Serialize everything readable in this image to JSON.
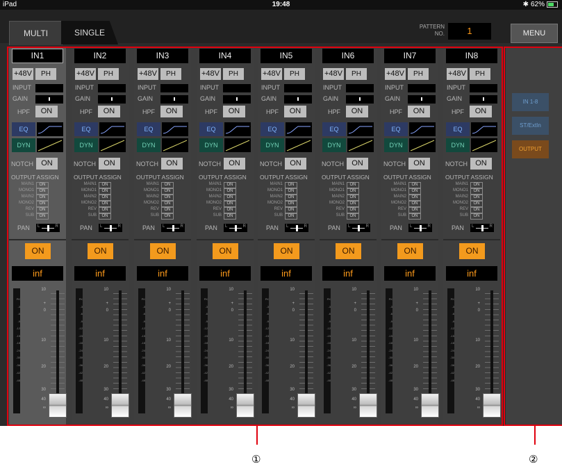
{
  "status": {
    "device": "iPad",
    "time": "19:48",
    "battery": "62%"
  },
  "tabs": {
    "multi": "MULTI",
    "single": "SINGLE"
  },
  "pattern": {
    "label_line1": "PATTERN",
    "label_line2": "NO.",
    "value": "1"
  },
  "menu": {
    "label": "MENU"
  },
  "channels": [
    {
      "name": "IN1"
    },
    {
      "name": "IN2"
    },
    {
      "name": "IN3"
    },
    {
      "name": "IN4"
    },
    {
      "name": "IN5"
    },
    {
      "name": "IN6"
    },
    {
      "name": "IN7"
    },
    {
      "name": "IN8"
    }
  ],
  "strip": {
    "phantom_label": "+48V",
    "ph_label": "PH",
    "input_label": "INPUT",
    "gain_label": "GAIN",
    "hpf_label": "HPF",
    "on_label": "ON",
    "eq_label": "EQ",
    "dyn_label": "DYN",
    "notch_label": "NOTCH",
    "output_assign_label": "OUTPUT ASSIGN",
    "assign": [
      {
        "label": "MAIN1",
        "state": "ON"
      },
      {
        "label": "MONO1",
        "state": "ON"
      },
      {
        "label": "MAIN2",
        "state": "ON"
      },
      {
        "label": "MONO2",
        "state": "ON"
      },
      {
        "label": "REV",
        "state": "ON"
      },
      {
        "label": "SUB",
        "state": "ON"
      }
    ],
    "pan_label": "PAN",
    "pan_l": "L",
    "pan_r": "R",
    "channel_on_label": "ON",
    "level": "inf",
    "meter_scale": [
      "PK",
      "-3",
      "-6",
      "-9",
      "-12",
      "-15",
      "-18",
      "-24",
      "-30",
      "-36",
      "-42",
      "-48"
    ],
    "fader_scale": [
      "10",
      "+",
      "0",
      "10",
      "20",
      "30",
      "40",
      "∞"
    ]
  },
  "right_panel": {
    "buttons": [
      "IN 1-8",
      "ST/ExtIn",
      "OUTPUT"
    ],
    "active": "OUTPUT"
  },
  "callouts": [
    "①",
    "②"
  ],
  "colors": {
    "accent": "#f39a1d",
    "highlight_frame": "#e0000e",
    "eq": "#2d3a63",
    "dyn": "#12493d"
  }
}
